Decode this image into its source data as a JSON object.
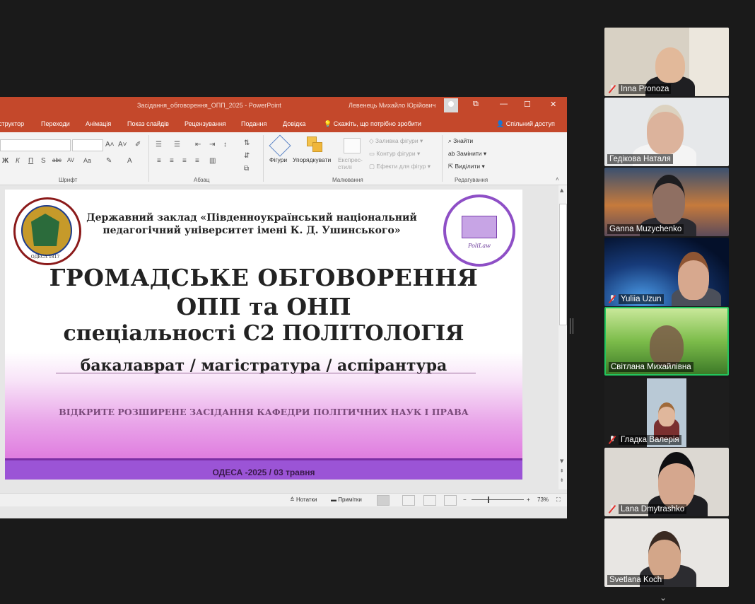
{
  "ppt": {
    "doc_title": "Засідання_обговорення_ОПП_2025 - PowerPoint",
    "user_name": "Левенець Михайло Юрійович",
    "window_controls": [
      "⧉",
      "—",
      "☐",
      "✕"
    ],
    "menu": [
      "структор",
      "Переходи",
      "Анімація",
      "Показ слайдів",
      "Рецензування",
      "Подання",
      "Довідка"
    ],
    "tell_me": "Скажіть, що потрібно зробити",
    "share": "Спільний доступ",
    "ribbon": {
      "font_group": "Шрифт",
      "font_buttons": [
        "Ж",
        "К",
        "П",
        "S",
        "abc",
        "AV",
        "Aa"
      ],
      "paragraph_group": "Абзац",
      "drawing_group": "Малювання",
      "shapes": "Фігури",
      "arrange": "Упорядкувати",
      "quick_styles": "Експрес-стилі",
      "shape_fill": "Заливка фігури",
      "shape_outline": "Контур фігури",
      "shape_effects": "Ефекти для фігур",
      "editing_group": "Редагування",
      "find": "Знайти",
      "replace": "Замінити",
      "select": "Виділити"
    },
    "status": {
      "notes": "Нотатки",
      "comments": "Примітки",
      "zoom": "73%"
    }
  },
  "slide": {
    "institution_1": "Державний заклад «Південноукраїнський національний",
    "institution_2": "педагогічний університет імені К. Д. Ушинського»",
    "title_1": "ГРОМАДСЬКЕ ОБГОВОРЕННЯ",
    "title_2": "ОПП та ОНП",
    "title_3": "спеціальності С2 ПОЛІТОЛОГІЯ",
    "levels": "бакалаврат / магістратура / аспірантура",
    "meeting": "ВІДКРИТЕ РОЗШИРЕНЕ ЗАСІДАННЯ КАФЕДРИ ПОЛІТИЧНИХ НАУК І ПРАВА",
    "footer": "ОДЕСА -2025   / 03 травня",
    "seal_left_text": "ОДЕСА\n1817",
    "seal_right_text": "PoliLaw"
  },
  "participants": [
    {
      "name": "Inna Pronoza",
      "muted": true
    },
    {
      "name": "Гедікова Наталя",
      "muted": false
    },
    {
      "name": "Ganna Muzychenko",
      "muted": false
    },
    {
      "name": "Yuliia Uzun",
      "muted": true
    },
    {
      "name": "Світлана Михайлівна",
      "muted": false,
      "active": true
    },
    {
      "name": "Гладка Валерія",
      "muted": true
    },
    {
      "name": "Lana Dmytrashko",
      "muted": true
    },
    {
      "name": "Svetlana Koch",
      "muted": false
    }
  ],
  "colors": {
    "ppt_accent": "#c4482b",
    "active_speaker": "#23c55e",
    "slide_footer": "#9b54d6"
  }
}
